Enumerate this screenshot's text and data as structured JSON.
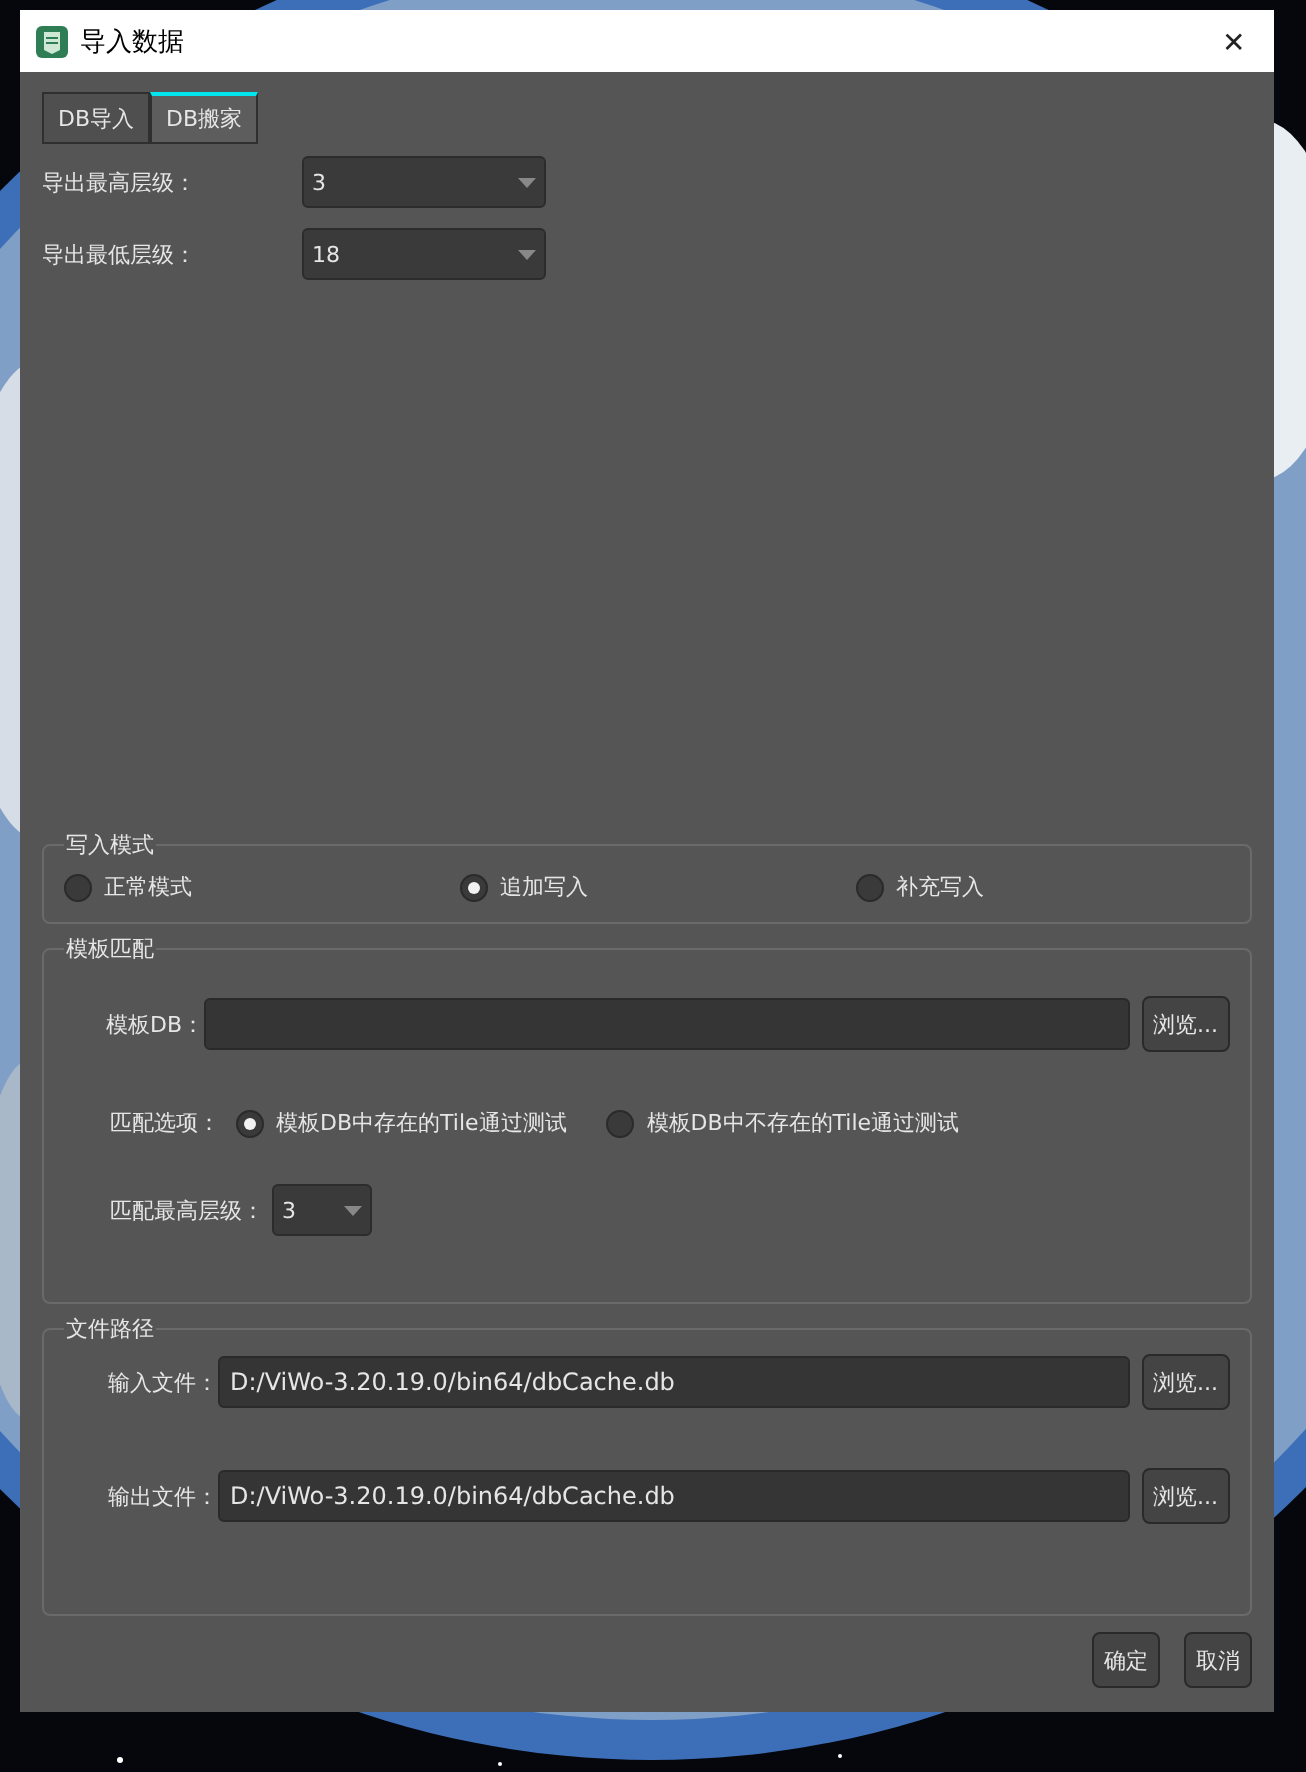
{
  "window": {
    "title": "导入数据",
    "close": "✕"
  },
  "tabs": [
    {
      "label": "DB导入",
      "selected": false
    },
    {
      "label": "DB搬家",
      "selected": true
    }
  ],
  "levels": [
    {
      "label": "导出最高层级：",
      "value": "3"
    },
    {
      "label": "导出最低层级：",
      "value": "18"
    }
  ],
  "write_mode": {
    "title": "写入模式",
    "options": [
      {
        "label": "正常模式",
        "selected": false
      },
      {
        "label": "追加写入",
        "selected": true
      },
      {
        "label": "补充写入",
        "selected": false
      }
    ]
  },
  "template_match": {
    "title": "模板匹配",
    "db_label": "模板DB：",
    "browse": "浏览...",
    "options_label": "匹配选项：",
    "options": [
      {
        "label": "模板DB中存在的Tile通过测试",
        "selected": true
      },
      {
        "label": "模板DB中不存在的Tile通过测试",
        "selected": false
      }
    ],
    "level_label": "匹配最高层级：",
    "level_value": "3"
  },
  "file_paths": {
    "title": "文件路径",
    "rows": [
      {
        "label": "输入文件：",
        "value": "D:/ViWo-3.20.19.0/bin64/dbCache.db",
        "browse": "浏览..."
      },
      {
        "label": "输出文件：",
        "value": "D:/ViWo-3.20.19.0/bin64/dbCache.db",
        "browse": "浏览..."
      }
    ]
  },
  "buttons": [
    "确定",
    "取消"
  ]
}
